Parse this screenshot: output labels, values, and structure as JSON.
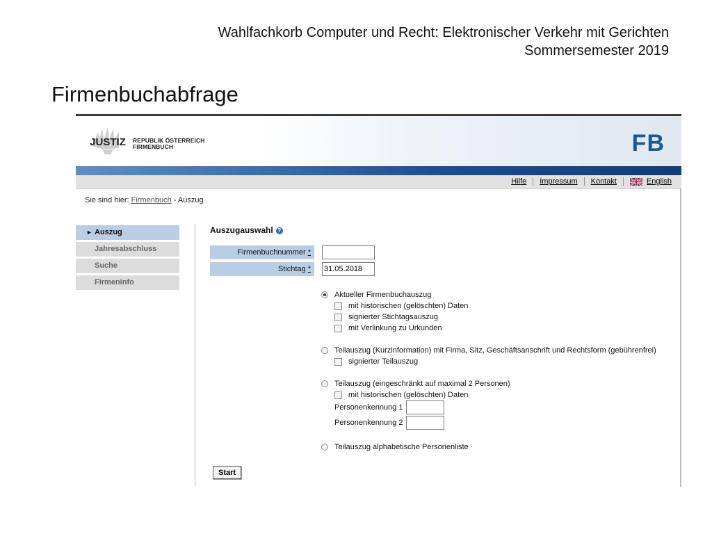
{
  "slide": {
    "header_line1": "Wahlfachkorb Computer und Recht: Elektronischer Verkehr mit Gerichten",
    "header_line2": "Sommersemester 2019",
    "title": "Firmenbuchabfrage"
  },
  "site": {
    "logo_text": "JUSTIZ",
    "org_line1": "REPUBLIK ÖSTERREICH",
    "org_line2": "FIRMENBUCH",
    "app_badge": "FB",
    "nav": [
      "Hilfe",
      "Impressum",
      "Kontakt",
      "English"
    ]
  },
  "breadcrumb": {
    "prefix": "Sie sind hier:",
    "link": "Firmenbuch",
    "current": "- Auszug"
  },
  "sidebar": {
    "items": [
      {
        "label": "Auszug",
        "active": true
      },
      {
        "label": "Jahresabschluss",
        "active": false
      },
      {
        "label": "Suche",
        "active": false
      },
      {
        "label": "Firmeninfo",
        "active": false
      }
    ]
  },
  "form": {
    "title": "Auszugauswahl",
    "fields": [
      {
        "label": "Firmenbuchnummer",
        "required_mark": "*",
        "value": ""
      },
      {
        "label": "Stichtag",
        "required_mark": "*",
        "value": "31.05.2018"
      }
    ],
    "options": [
      {
        "label": "Aktueller Firmenbuchauszug",
        "selected": true,
        "checks": [
          "mit historischen (gelöschten) Daten",
          "signierter Stichtagsauszug",
          "mit Verlinkung zu Urkunden"
        ]
      },
      {
        "label": "Teilauszug (Kurzinformation) mit Firma, Sitz, Geschäftsanschrift und Rechtsform (gebührenfrei)",
        "selected": false,
        "checks": [
          "signierter Teilauszug"
        ]
      },
      {
        "label": "Teilauszug (eingeschränkt auf maximal 2 Personen)",
        "selected": false,
        "checks": [
          "mit historischen (gelöschten) Daten"
        ],
        "person_fields": [
          "Personenkennung 1",
          "Personenkennung 2"
        ]
      },
      {
        "label": "Teilauszug alphabetische Personenliste",
        "selected": false,
        "checks": []
      }
    ],
    "submit_label": "Start"
  },
  "colors": {
    "label_bg": "#b9cde5",
    "banner_blue": "#1b4f8e",
    "fb_blue": "#1a5a94"
  }
}
